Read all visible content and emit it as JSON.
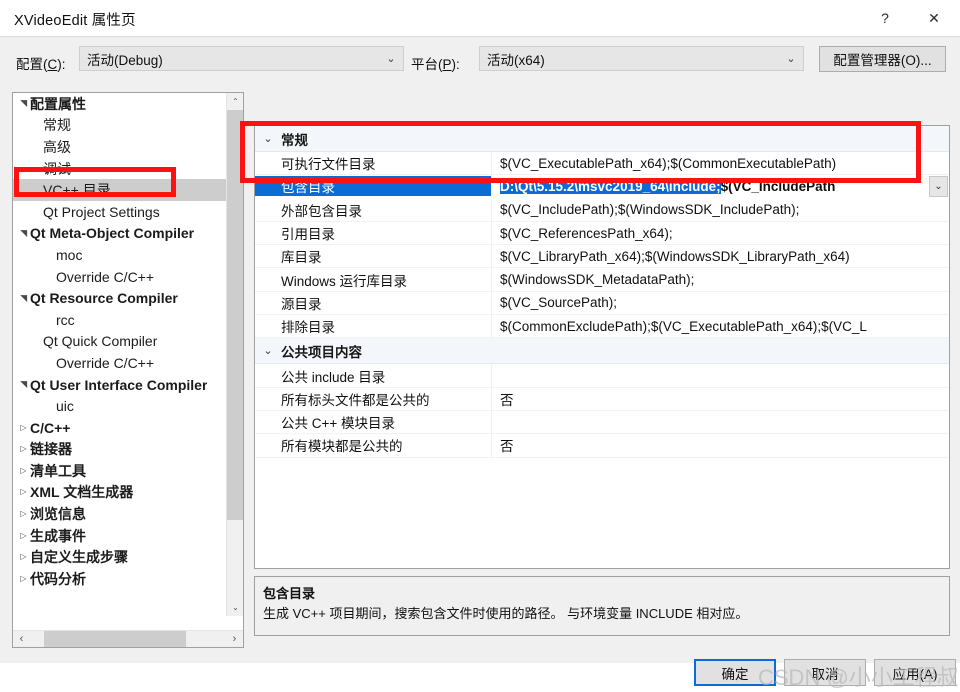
{
  "window": {
    "title": "XVideoEdit 属性页",
    "help_icon": "?",
    "close_icon": "✕"
  },
  "toolbar": {
    "config_label_pre": "配置(",
    "config_label_key": "C",
    "config_label_post": "):",
    "config_value": "活动(Debug)",
    "platform_label_pre": "平台(",
    "platform_label_key": "P",
    "platform_label_post": "):",
    "platform_value": "活动(x64)",
    "config_manager_button": "配置管理器(O)...",
    "chevron": "⌄"
  },
  "tree": {
    "nodes": [
      {
        "label": "配置属性",
        "depth": 0,
        "arrow": "▲",
        "expanded": true,
        "selected": false
      },
      {
        "label": "常规",
        "depth": 1,
        "arrow": "",
        "expanded": false,
        "selected": false
      },
      {
        "label": "高级",
        "depth": 1,
        "arrow": "",
        "expanded": false,
        "selected": false
      },
      {
        "label": "调试",
        "depth": 1,
        "arrow": "",
        "expanded": false,
        "selected": false
      },
      {
        "label": "VC++ 目录",
        "depth": 1,
        "arrow": "",
        "expanded": false,
        "selected": true
      },
      {
        "label": "Qt Project Settings",
        "depth": 1,
        "arrow": "",
        "expanded": false,
        "selected": false
      },
      {
        "label": "Qt Meta-Object Compiler",
        "depth": 0,
        "arrow": "▲",
        "expanded": true,
        "selected": false
      },
      {
        "label": "moc",
        "depth": 2,
        "arrow": "",
        "expanded": false,
        "selected": false
      },
      {
        "label": "Override C/C++",
        "depth": 2,
        "arrow": "",
        "expanded": false,
        "selected": false
      },
      {
        "label": "Qt Resource Compiler",
        "depth": 0,
        "arrow": "▲",
        "expanded": true,
        "selected": false
      },
      {
        "label": "rcc",
        "depth": 2,
        "arrow": "",
        "expanded": false,
        "selected": false
      },
      {
        "label": "Qt Quick Compiler",
        "depth": 1,
        "arrow": "",
        "expanded": false,
        "selected": false
      },
      {
        "label": "Override C/C++",
        "depth": 2,
        "arrow": "",
        "expanded": false,
        "selected": false
      },
      {
        "label": "Qt User Interface Compiler",
        "depth": 0,
        "arrow": "▲",
        "expanded": true,
        "selected": false
      },
      {
        "label": "uic",
        "depth": 2,
        "arrow": "",
        "expanded": false,
        "selected": false
      },
      {
        "label": "C/C++",
        "depth": 0,
        "arrow": "▷",
        "expanded": false,
        "selected": false
      },
      {
        "label": "链接器",
        "depth": 0,
        "arrow": "▷",
        "expanded": false,
        "selected": false
      },
      {
        "label": "清单工具",
        "depth": 0,
        "arrow": "▷",
        "expanded": false,
        "selected": false
      },
      {
        "label": "XML 文档生成器",
        "depth": 0,
        "arrow": "▷",
        "expanded": false,
        "selected": false
      },
      {
        "label": "浏览信息",
        "depth": 0,
        "arrow": "▷",
        "expanded": false,
        "selected": false
      },
      {
        "label": "生成事件",
        "depth": 0,
        "arrow": "▷",
        "expanded": false,
        "selected": false
      },
      {
        "label": "自定义生成步骤",
        "depth": 0,
        "arrow": "▷",
        "expanded": false,
        "selected": false
      },
      {
        "label": "代码分析",
        "depth": 0,
        "arrow": "▷",
        "expanded": false,
        "selected": false
      }
    ],
    "scroll_up_icon": "⌃",
    "scroll_down_icon": "⌄",
    "scroll_left_icon": "‹",
    "scroll_right_icon": "›"
  },
  "grid": {
    "chevron_expanded": "⌄",
    "dropdown_icon": "⌄",
    "categories": [
      {
        "title": "常规",
        "rows": [
          {
            "name": "可执行文件目录",
            "value": "$(VC_ExecutablePath_x64);$(CommonExecutablePath)",
            "selected": false,
            "editing": false
          },
          {
            "name": "包含目录",
            "value": "D:\\Qt\\5.15.2\\msvc2019_64\\include;$(VC_IncludePath",
            "selected": true,
            "editing": true,
            "value_selected_part": "D:\\Qt\\5.15.2\\msvc2019_64\\include;",
            "value_rest_part": "$(VC_IncludePath"
          },
          {
            "name": "外部包含目录",
            "value": "$(VC_IncludePath);$(WindowsSDK_IncludePath);",
            "selected": false,
            "editing": false
          },
          {
            "name": "引用目录",
            "value": "$(VC_ReferencesPath_x64);",
            "selected": false,
            "editing": false
          },
          {
            "name": "库目录",
            "value": "$(VC_LibraryPath_x64);$(WindowsSDK_LibraryPath_x64)",
            "selected": false,
            "editing": false
          },
          {
            "name": "Windows 运行库目录",
            "value": "$(WindowsSDK_MetadataPath);",
            "selected": false,
            "editing": false
          },
          {
            "name": "源目录",
            "value": "$(VC_SourcePath);",
            "selected": false,
            "editing": false
          },
          {
            "name": "排除目录",
            "value": "$(CommonExcludePath);$(VC_ExecutablePath_x64);$(VC_L",
            "selected": false,
            "editing": false
          }
        ]
      },
      {
        "title": "公共项目内容",
        "rows": [
          {
            "name": "公共 include 目录",
            "value": "",
            "selected": false,
            "editing": false
          },
          {
            "name": "所有标头文件都是公共的",
            "value": "否",
            "selected": false,
            "editing": false
          },
          {
            "name": "公共 C++ 模块目录",
            "value": "",
            "selected": false,
            "editing": false
          },
          {
            "name": "所有模块都是公共的",
            "value": "否",
            "selected": false,
            "editing": false
          }
        ]
      }
    ]
  },
  "description": {
    "title": "包含目录",
    "body": "生成 VC++ 项目期间，搜索包含文件时使用的路径。 与环境变量 INCLUDE 相对应。"
  },
  "footer": {
    "ok": "确定",
    "cancel": "取消",
    "apply": "应用(A)"
  },
  "watermark": {
    "text": "CSDN @小小工程叔"
  },
  "colors": {
    "accent": "#0a6cd4",
    "annotation": "#fb1212",
    "dialog_bg": "#f0f0f0",
    "selection": "#cdcdcd"
  }
}
